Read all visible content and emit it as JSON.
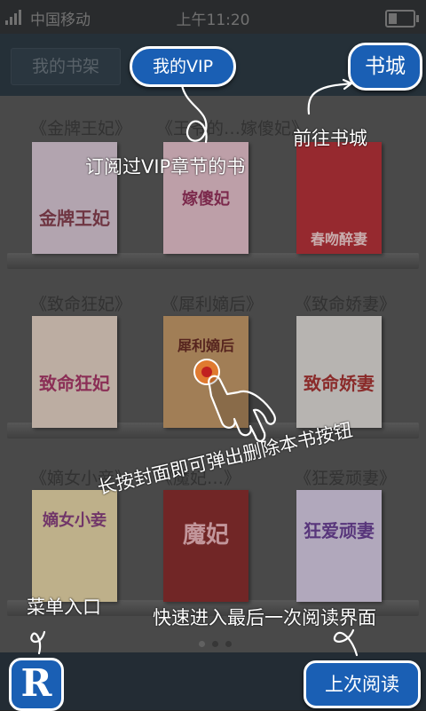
{
  "status_bar": {
    "carrier": "中国移动",
    "time": "上午11:20"
  },
  "header": {
    "my_shelf_tab": "我的书架",
    "vip_button": "我的VIP",
    "store_button": "书城"
  },
  "books": [
    {
      "title": "《金牌王妃》",
      "cover_text": "金牌王妃",
      "cover_color": "#d9c9d6"
    },
    {
      "title": "《王爷的…嫁傻妃》",
      "cover_text": "嫁傻妃",
      "cover_color": "#e7c3cd"
    },
    {
      "title": "《…书城》",
      "cover_text": "春吻醉妻",
      "cover_color": "#b8323a"
    },
    {
      "title": "《致命狂妃》",
      "cover_text": "致命狂妃",
      "cover_color": "#e6d3c6"
    },
    {
      "title": "《犀利嫡后》",
      "cover_text": "犀利嫡后",
      "cover_color": "#c59a6a"
    },
    {
      "title": "《致命娇妻》",
      "cover_text": "致命娇妻",
      "cover_color": "#e0dcd8"
    },
    {
      "title": "《嫡女小妾》",
      "cover_text": "嫡女小妾",
      "cover_color": "#e8d7a9"
    },
    {
      "title": "《魔妃…》",
      "cover_text": "魔妃",
      "cover_color": "#8a2f2f"
    },
    {
      "title": "《狂爱顽妻》",
      "cover_text": "狂爱顽妻",
      "cover_color": "#d8cde6"
    }
  ],
  "annotations": {
    "vip": "订阅过VIP章节的书",
    "store": "前往书城",
    "long_press": "长按封面即可弹出删除本书按钮",
    "menu": "菜单入口",
    "last_read": "快速进入最后一次阅读界面"
  },
  "bottom": {
    "last_read_button": "上次阅读",
    "menu_logo": "R"
  },
  "colors": {
    "accent": "#1a5fb4"
  },
  "icons": [
    "signal-icon",
    "battery-icon",
    "hand-pointer-icon"
  ]
}
